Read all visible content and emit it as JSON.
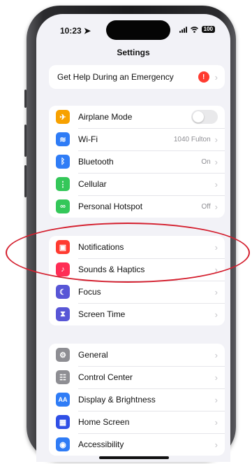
{
  "status": {
    "time": "10:23",
    "battery": "100"
  },
  "nav": {
    "title": "Settings"
  },
  "emergency": {
    "label": "Get Help During an Emergency",
    "badge": "!"
  },
  "connectivity": [
    {
      "label": "Airplane Mode",
      "icon": "airplane-icon",
      "color": "#f7a100",
      "glyph": "✈",
      "value": "",
      "toggle": "off"
    },
    {
      "label": "Wi-Fi",
      "icon": "wifi-icon",
      "color": "#2f7cf6",
      "glyph": "≋",
      "value": "1040 Fulton"
    },
    {
      "label": "Bluetooth",
      "icon": "bluetooth-icon",
      "color": "#2f7cf6",
      "glyph": "ᛒ",
      "value": "On"
    },
    {
      "label": "Cellular",
      "icon": "cellular-icon",
      "color": "#34c759",
      "glyph": "⋮",
      "value": ""
    },
    {
      "label": "Personal Hotspot",
      "icon": "hotspot-icon",
      "color": "#34c759",
      "glyph": "∞",
      "value": "Off"
    }
  ],
  "notify": [
    {
      "label": "Notifications",
      "icon": "notifications-icon",
      "color": "#ff3b30",
      "glyph": "▣"
    },
    {
      "label": "Sounds & Haptics",
      "icon": "sounds-icon",
      "color": "#ff2d55",
      "glyph": "♪"
    },
    {
      "label": "Focus",
      "icon": "focus-icon",
      "color": "#5856d6",
      "glyph": "☾"
    },
    {
      "label": "Screen Time",
      "icon": "screen-time-icon",
      "color": "#5856d6",
      "glyph": "⧗"
    }
  ],
  "general": [
    {
      "label": "General",
      "icon": "gear-icon",
      "color": "#8e8e93",
      "glyph": "⚙"
    },
    {
      "label": "Control Center",
      "icon": "control-center-icon",
      "color": "#8e8e93",
      "glyph": "☷"
    },
    {
      "label": "Display & Brightness",
      "icon": "display-icon",
      "color": "#2f7cf6",
      "glyph": "AA"
    },
    {
      "label": "Home Screen",
      "icon": "home-screen-icon",
      "color": "#2f4fe6",
      "glyph": "▦"
    },
    {
      "label": "Accessibility",
      "icon": "accessibility-icon",
      "color": "#2f7cf6",
      "glyph": "◉"
    }
  ],
  "annotation": {
    "color": "#d41f2e"
  }
}
